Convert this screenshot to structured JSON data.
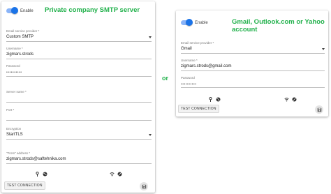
{
  "colors": {
    "accent": "#1a73e8",
    "heading": "#22b14c"
  },
  "left_panel": {
    "heading": "Private company SMTP server",
    "enable_label": "Enable",
    "fields": [
      {
        "label": "Email service provider *",
        "value": "Custom SMTP",
        "type": "select"
      },
      {
        "label": "Username *",
        "value": "zigmars.strods",
        "type": "text"
      },
      {
        "label": "Password",
        "value": "••••••••••",
        "type": "password"
      },
      {
        "label": "Server name *",
        "value": "",
        "type": "text"
      },
      {
        "label": "Port *",
        "value": "",
        "type": "text"
      },
      {
        "label": "Encryption",
        "value": "StartTLS",
        "type": "select"
      },
      {
        "label": "\"From\" address *",
        "value": "zigmars.strods@saftehnika.com",
        "type": "text"
      }
    ],
    "test_button": "TEST CONNECTION",
    "icons": [
      "key-icon",
      "globe-icon",
      "wifi-icon",
      "globe-off-icon",
      "save-icon"
    ]
  },
  "or_text": "or",
  "right_panel": {
    "heading_line1": "Gmail, Outlook.com or Yahoo",
    "heading_line2": "account",
    "enable_label": "Enable",
    "fields": [
      {
        "label": "Email service provider *",
        "value": "Gmail",
        "type": "select"
      },
      {
        "label": "Username *",
        "value": "zigmars.strods@gmail.com",
        "type": "text"
      },
      {
        "label": "Password",
        "value": "••••••••••",
        "type": "password"
      }
    ],
    "test_button": "TEST CONNECTION",
    "icons": [
      "key-icon",
      "globe-icon",
      "wifi-icon",
      "globe-off-icon",
      "save-icon"
    ]
  }
}
